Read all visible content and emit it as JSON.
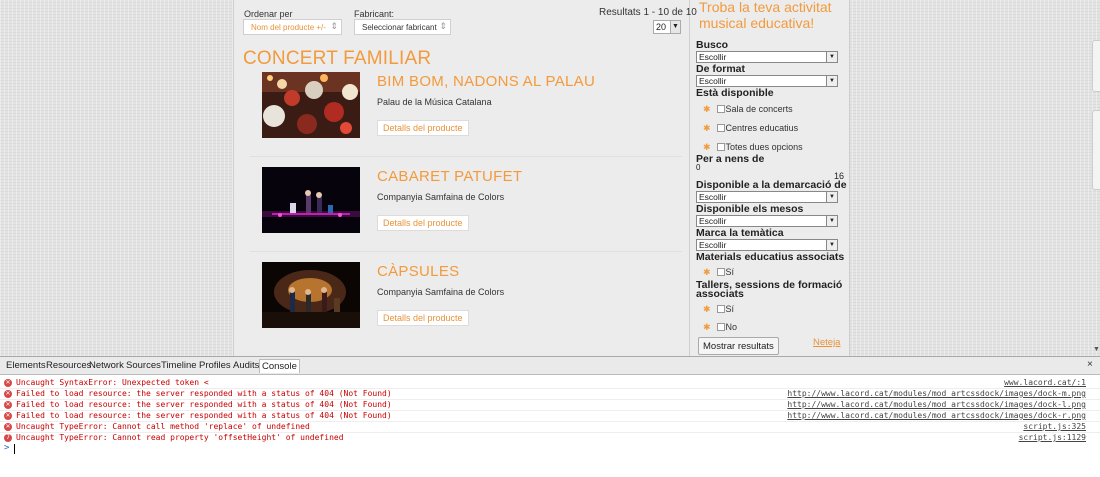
{
  "filters": {
    "order_label": "Ordenar per",
    "order_value": "Nom del producte +/-",
    "maker_label": "Fabricant:",
    "maker_value": "Seleccionar fabricant",
    "results_text": "Resultats 1 - 10 de 10",
    "per_page": "20"
  },
  "category": {
    "title": "CONCERT FAMILIAR"
  },
  "products": [
    {
      "title": "BIM BOM, NADONS AL PALAU",
      "subtitle": "Palau de la Música Catalana",
      "button": "Detalls del producte"
    },
    {
      "title": "CABARET PATUFET",
      "subtitle": "Companyia Samfaina de Colors",
      "button": "Detalls del producte"
    },
    {
      "title": "CÀPSULES",
      "subtitle": "Companyia Samfaina de Colors",
      "button": "Detalls del producte"
    }
  ],
  "sidebar": {
    "title_line1": "Troba la teva activitat",
    "title_line2": "musical educativa!",
    "busco_label": "Busco",
    "busco_value": "Escollir",
    "format_label": "De format",
    "format_value": "Escollir",
    "available_label": "Està disponible",
    "available_options": [
      "Sala de concerts",
      "Centres educatius",
      "Totes dues opcions"
    ],
    "age_label": "Per a nens de",
    "age_min": "0",
    "age_max": "16",
    "demarcacio_label": "Disponible a la demarcació de",
    "demarcacio_value": "Escollir",
    "months_label": "Disponible els mesos",
    "months_value": "Escollir",
    "theme_label": "Marca la temàtica",
    "theme_value": "Escollir",
    "materials_label": "Materials educatius associats",
    "materials_option": "Sí",
    "workshops_label_line1": "Tallers, sessions de formació",
    "workshops_label_line2": "associats",
    "workshops_options": [
      "Sí",
      "No"
    ],
    "show_button": "Mostrar resultats",
    "clear_link": "Neteja"
  },
  "devtools": {
    "tabs": [
      "Elements",
      "Resources",
      "Network",
      "Sources",
      "Timeline",
      "Profiles",
      "Audits",
      "Console"
    ],
    "active_tab": "Console",
    "close_glyph": "×",
    "prompt": ">",
    "logs": [
      {
        "message": "Uncaught SyntaxError: Unexpected token <",
        "source": "www.lacord.cat/:1",
        "count": ""
      },
      {
        "message": "Failed to load resource: the server responded with a status of 404 (Not Found)",
        "source": "http://www.lacord.cat/modules/mod_artcssdock/images/dock-m.png",
        "count": ""
      },
      {
        "message": "Failed to load resource: the server responded with a status of 404 (Not Found)",
        "source": "http://www.lacord.cat/modules/mod_artcssdock/images/dock-l.png",
        "count": ""
      },
      {
        "message": "Failed to load resource: the server responded with a status of 404 (Not Found)",
        "source": "http://www.lacord.cat/modules/mod_artcssdock/images/dock-r.png",
        "count": ""
      },
      {
        "message": "Uncaught TypeError: Cannot call method 'replace' of undefined",
        "source": "script.js:325",
        "count": ""
      },
      {
        "message": "Uncaught TypeError: Cannot read property 'offsetHeight' of undefined",
        "source": "script.js:1129",
        "count": "7"
      }
    ]
  },
  "colors": {
    "accent_orange": "#f39a3c",
    "error_red": "#c80000",
    "page_bg": "#ececec"
  }
}
